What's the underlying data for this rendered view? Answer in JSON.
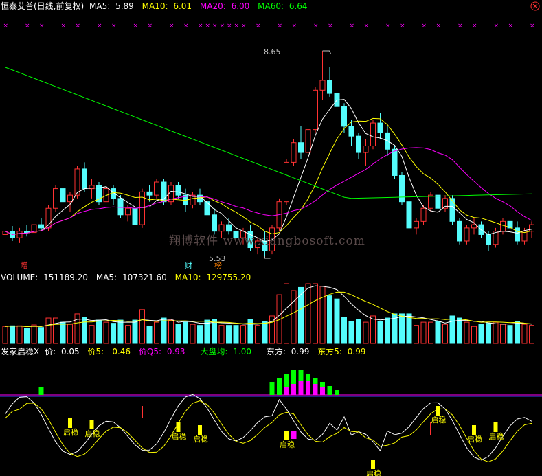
{
  "price_panel": {
    "stock_name": "恒泰艾普(日线,前复权)",
    "ma": [
      {
        "label": "MA5:",
        "value": "5.89",
        "color": "#ffffff"
      },
      {
        "label": "MA10:",
        "value": "6.01",
        "color": "#ffff00"
      },
      {
        "label": "MA20:",
        "value": "6.00",
        "color": "#ff00ff"
      },
      {
        "label": "MA60:",
        "value": "6.64",
        "color": "#00ff00"
      }
    ],
    "high_label": "8.65",
    "low_label": "5.53",
    "event_tags": [
      "增",
      "财",
      "榜"
    ],
    "watermark": "翔博软件 www.xiangbosoft.com"
  },
  "volume_panel": {
    "title": "VOLUME:",
    "value": "151189.20",
    "ma5_label": "MA5:",
    "ma5": "107321.60",
    "ma10_label": "MA10:",
    "ma10": "129755.20"
  },
  "indicator_panel": {
    "name": "发家启稳X",
    "fields": [
      {
        "label": "价:",
        "value": "0.05",
        "color": "#ffffff"
      },
      {
        "label": "价5:",
        "value": "-0.46",
        "color": "#ffff00"
      },
      {
        "label": "价Q5:",
        "value": "0.93",
        "color": "#ff00ff"
      },
      {
        "label": "大盘均:",
        "value": "1.00",
        "color": "#00ff00"
      },
      {
        "label": "东方:",
        "value": "0.99",
        "color": "#ffffff"
      },
      {
        "label": "东方5:",
        "value": "0.99",
        "color": "#ffff00"
      }
    ],
    "signal_label": "启稳"
  },
  "colors": {
    "up": "#ff3232",
    "down": "#54fcfc",
    "ma5": "#ffffff",
    "ma10": "#ffff00",
    "ma20": "#ff00ff",
    "ma60": "#00ff00",
    "grid": "#8b0000"
  },
  "chart_data": {
    "type": "candlestick",
    "y_range": [
      5.53,
      8.65
    ],
    "candles": [
      [
        5.85,
        5.95,
        5.7,
        5.9
      ],
      [
        5.9,
        5.98,
        5.75,
        5.8
      ],
      [
        5.8,
        5.95,
        5.72,
        5.9
      ],
      [
        5.9,
        6.0,
        5.82,
        5.88
      ],
      [
        5.88,
        6.05,
        5.8,
        6.0
      ],
      [
        6.0,
        6.1,
        5.9,
        5.95
      ],
      [
        5.95,
        6.3,
        5.9,
        6.25
      ],
      [
        6.25,
        6.6,
        6.2,
        6.55
      ],
      [
        6.55,
        6.6,
        6.3,
        6.35
      ],
      [
        6.35,
        6.5,
        6.2,
        6.45
      ],
      [
        6.45,
        6.9,
        6.4,
        6.85
      ],
      [
        6.85,
        6.95,
        6.5,
        6.55
      ],
      [
        6.55,
        6.7,
        6.4,
        6.6
      ],
      [
        6.6,
        6.65,
        6.3,
        6.35
      ],
      [
        6.35,
        6.6,
        6.3,
        6.55
      ],
      [
        6.55,
        6.6,
        6.3,
        6.4
      ],
      [
        6.4,
        6.45,
        6.1,
        6.15
      ],
      [
        6.15,
        6.3,
        6.05,
        6.25
      ],
      [
        6.25,
        6.3,
        5.95,
        6.0
      ],
      [
        6.0,
        6.55,
        5.95,
        6.5
      ],
      [
        6.5,
        6.6,
        6.35,
        6.45
      ],
      [
        6.45,
        6.7,
        6.4,
        6.65
      ],
      [
        6.65,
        6.7,
        6.3,
        6.35
      ],
      [
        6.35,
        6.65,
        6.3,
        6.6
      ],
      [
        6.6,
        6.65,
        6.4,
        6.45
      ],
      [
        6.45,
        6.55,
        6.2,
        6.3
      ],
      [
        6.3,
        6.5,
        6.25,
        6.45
      ],
      [
        6.45,
        6.55,
        6.3,
        6.35
      ],
      [
        6.35,
        6.5,
        6.1,
        6.15
      ],
      [
        6.15,
        6.25,
        5.85,
        5.9
      ],
      [
        5.9,
        6.05,
        5.8,
        6.0
      ],
      [
        6.0,
        6.1,
        5.85,
        5.9
      ],
      [
        5.9,
        6.0,
        5.75,
        5.8
      ],
      [
        5.8,
        5.95,
        5.7,
        5.9
      ],
      [
        5.9,
        6.0,
        5.6,
        5.65
      ],
      [
        5.65,
        5.8,
        5.55,
        5.75
      ],
      [
        5.75,
        5.9,
        5.53,
        5.6
      ],
      [
        5.6,
        6.0,
        5.55,
        5.95
      ],
      [
        5.95,
        6.4,
        5.9,
        6.35
      ],
      [
        6.35,
        7.0,
        6.3,
        6.95
      ],
      [
        6.95,
        7.3,
        6.9,
        7.25
      ],
      [
        7.25,
        7.5,
        7.0,
        7.1
      ],
      [
        7.1,
        7.5,
        7.05,
        7.45
      ],
      [
        7.45,
        8.1,
        7.4,
        8.05
      ],
      [
        8.05,
        8.65,
        7.9,
        8.2
      ],
      [
        8.2,
        8.4,
        7.95,
        8.0
      ],
      [
        8.0,
        8.2,
        7.7,
        7.8
      ],
      [
        7.8,
        7.85,
        7.4,
        7.5
      ],
      [
        7.5,
        7.6,
        7.2,
        7.35
      ],
      [
        7.35,
        7.4,
        7.0,
        7.1
      ],
      [
        7.1,
        7.3,
        6.9,
        7.2
      ],
      [
        7.2,
        7.6,
        7.15,
        7.55
      ],
      [
        7.55,
        7.7,
        7.3,
        7.4
      ],
      [
        7.4,
        7.5,
        7.05,
        7.15
      ],
      [
        7.15,
        7.2,
        6.7,
        6.75
      ],
      [
        6.75,
        6.8,
        6.3,
        6.35
      ],
      [
        6.35,
        6.4,
        5.9,
        5.95
      ],
      [
        5.95,
        6.1,
        5.85,
        6.05
      ],
      [
        6.05,
        6.3,
        6.0,
        6.25
      ],
      [
        6.25,
        6.5,
        6.2,
        6.45
      ],
      [
        6.45,
        6.55,
        6.2,
        6.25
      ],
      [
        6.25,
        6.45,
        6.2,
        6.4
      ],
      [
        6.4,
        6.45,
        6.0,
        6.05
      ],
      [
        6.05,
        6.1,
        5.7,
        5.75
      ],
      [
        5.75,
        6.0,
        5.7,
        5.95
      ],
      [
        5.95,
        6.1,
        5.85,
        6.0
      ],
      [
        6.0,
        6.05,
        5.8,
        5.85
      ],
      [
        5.85,
        5.9,
        5.6,
        5.7
      ],
      [
        5.7,
        5.95,
        5.65,
        5.9
      ],
      [
        5.9,
        6.1,
        5.85,
        6.05
      ],
      [
        6.05,
        6.15,
        5.9,
        5.95
      ],
      [
        5.95,
        6.05,
        5.7,
        5.75
      ],
      [
        5.75,
        5.95,
        5.7,
        5.9
      ],
      [
        5.9,
        6.05,
        5.8,
        6.0
      ]
    ]
  }
}
